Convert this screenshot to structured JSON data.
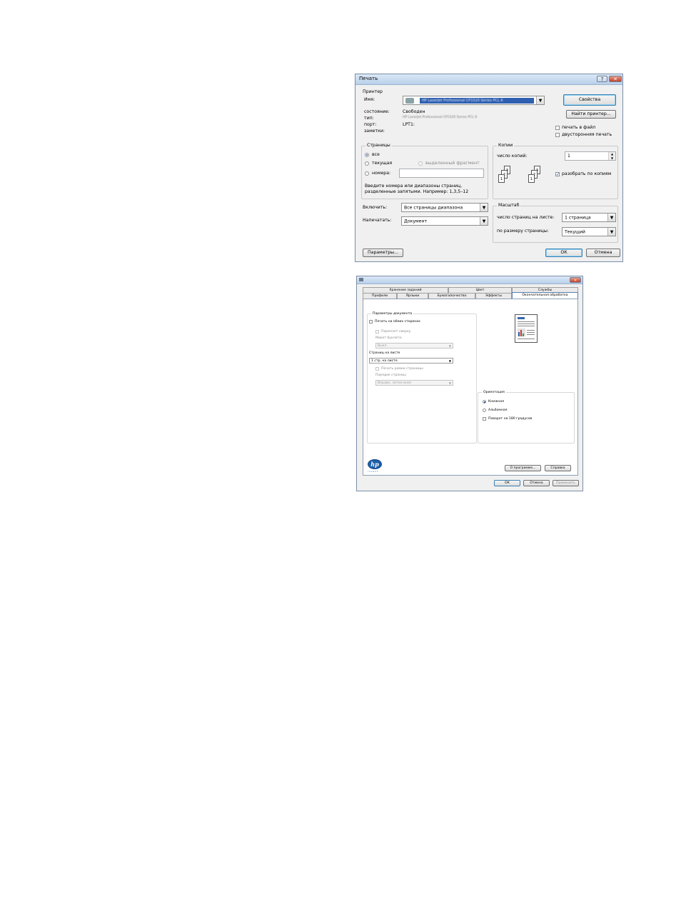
{
  "print_dialog": {
    "title": "Печать",
    "printer_group": "Принтер",
    "name_label": "Имя:",
    "name_value": "HP LaserJet Professional CP1520 Series PCL 6",
    "status_label": "состояние:",
    "status_value": "Свободен",
    "type_label": "тип:",
    "type_value": "HP LaserJet Professional CP1520 Series PCL 6",
    "port_label": "порт:",
    "port_value": "LPT1:",
    "notes_label": "заметки:",
    "properties_button": "Свойства",
    "find_printer_button": "Найти принтер...",
    "print_to_file": "печать в файл",
    "duplex": "двусторонняя печать",
    "pages_group": "Страницы",
    "pages_all": "все",
    "pages_current": "текущая",
    "pages_selection": "выделенный фрагмент",
    "pages_numbers": "номера:",
    "pages_hint_1": "Введите номера или диапазоны страниц,",
    "pages_hint_2": "разделенные запятыми. Например: 1,3,5–12",
    "copies_group": "Копии",
    "copies_label": "число копий:",
    "copies_value": "1",
    "collate": "разобрать по копиям",
    "include_label": "Включить:",
    "include_value": "Все страницы диапазона",
    "print_what_label": "Напечатать:",
    "print_what_value": "Документ",
    "zoom_group": "Масштаб",
    "pages_per_sheet_label": "число страниц на листе:",
    "pages_per_sheet_value": "1 страница",
    "scale_to_label": "по размеру страницы:",
    "scale_to_value": "Текущий",
    "options_button": "Параметры...",
    "ok_button": "ОК",
    "cancel_button": "Отмена",
    "help_glyph": "?",
    "close_glyph": "✕"
  },
  "props_dialog": {
    "close_glyph": "✕",
    "tabs_top": [
      "Хранение заданий",
      "Цвет",
      "Службы"
    ],
    "tabs_bottom": [
      "Профили",
      "Ярлыки",
      "Бумага/качество",
      "Эффекты",
      "Окончательная обработка"
    ],
    "doc_options_group": "Параметры документа",
    "print_both_sides": "Печать на обеих сторонах",
    "flip_pages_up": "Переплет сверху",
    "booklet_layout": "Макет буклета:",
    "booklet_value": "Выкл.",
    "pages_per_sheet": "Страниц на листе",
    "pages_per_sheet_value": "1 стр. на листе",
    "print_page_borders": "Печать рамки страницы",
    "page_order": "Порядок страниц:",
    "page_order_value": "Вправо, затем вниз",
    "orientation_group": "Ориентация",
    "portrait": "Книжная",
    "landscape": "Альбомная",
    "rotate_180": "Поворот на 180 градусов",
    "about_button": "О программе...",
    "help_button": "Справка",
    "ok_button": "ОК",
    "cancel_button": "Отмена",
    "apply_button": "Применить",
    "logo_text": "hp",
    "logo_tagline": "invent"
  }
}
